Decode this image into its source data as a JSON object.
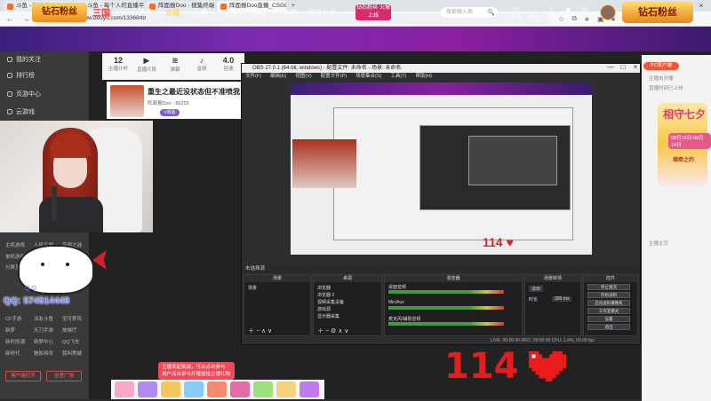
{
  "browser": {
    "tabs": [
      {
        "label": "斗鱼 - 哪个赛程 Bing"
      },
      {
        "label": "斗鱼 - 每个人的直播平台"
      },
      {
        "label": "阵面报Doo - 搜集终端 - 斗鱼直"
      },
      {
        "label": "阵面报Doo直播_CSGO直播_斗鱼"
      }
    ],
    "url": "https://www.douyu.com/1336849"
  },
  "douyu_header": {
    "logo": "钻石粉丝",
    "game_badge": "三国",
    "nav": [
      "首页",
      "直播",
      "分类",
      "视频",
      "游戏",
      "鱼吧",
      "相守七夕"
    ],
    "promo": "钻石粉丝 火爆上线",
    "search_placeholder": "搜索输入框",
    "icons": [
      "历史",
      "关注",
      "下载",
      "开播",
      "私信"
    ],
    "brand2": "钻石粉丝"
  },
  "sidebar": {
    "items": [
      "我的关注",
      "排行榜",
      "页游中心",
      "云游戏"
    ],
    "small": [
      "主机游戏",
      "人机互娱",
      "音频之谜",
      "单机游戏",
      "分屏显示",
      "单机英雄",
      "奇迹之旅",
      "CF手游",
      "派友斗鱼",
      "宝可梦风",
      "新梦",
      "天刀手游",
      "放映厅",
      "新时尚潮",
      "新梦中心",
      "QQ飞车",
      "新时代",
      "魅影特攻",
      "我叫秀城"
    ],
    "btn1": "客户端打开",
    "btn2": "创意广场"
  },
  "stats": [
    {
      "value": "12",
      "label": "主播计时"
    },
    {
      "value": "",
      "label": "直播片段"
    },
    {
      "value": "",
      "label": "弹幕"
    },
    {
      "value": "",
      "label": "音频"
    },
    {
      "value": "4.0",
      "label": "倍速"
    }
  ],
  "anchor": {
    "title": "重生之最近没状态但不准喷我！",
    "name": "阵面报Doo",
    "hot": "80255",
    "tag": "V观看"
  },
  "overlay": {
    "qq": "QQ: 574514448",
    "hint": "Q Q",
    "count": "114"
  },
  "obs": {
    "title": "OBS 27.0.1 (64-bit, windows) - 配置文件: 未命名 - 场景: 未命名",
    "menu": [
      "文件(F)",
      "编辑(E)",
      "视图(V)",
      "配置文件(P)",
      "场景集合(S)",
      "工具(T)",
      "帮助(H)"
    ],
    "scene_bar": "未选择源",
    "panels": {
      "scenes": {
        "header": "场景",
        "items": [
          "场景"
        ]
      },
      "sources": {
        "header": "来源",
        "items": [
          "浏览器",
          "浏览器 2",
          "视频采集设备",
          "游戏源",
          "显示器采集"
        ]
      },
      "mixer": {
        "header": "混音器",
        "tracks": [
          "桌面音频",
          "Mic/Aux",
          "麦克风/辅助音频"
        ]
      },
      "transitions": {
        "header": "场景转场",
        "type": "淡出",
        "duration_label": "时长",
        "duration": "300 ms"
      },
      "controls": {
        "header": "控件",
        "buttons": [
          "停止推流",
          "开始录制",
          "启动虚拟摄像机",
          "工作室模式",
          "设置",
          "退出"
        ]
      }
    },
    "status": "LIVE: 00:00:00    REC: 00:00:00    CPU: 1.4%, 60.00 fps"
  },
  "right_panel": {
    "pc_btn": "PC客户端",
    "promo_title": "相守七夕",
    "promo_date": "08月12日-08月14日",
    "promo_sub": "缘牵之约",
    "lines": [
      "主播未开播",
      "直播时间已上线",
      "主播主页"
    ]
  },
  "danmu_tip": "主播发起挑战，可以点击参与 用户点击参与并赠送给主播礼物",
  "colors": {
    "douyu_orange": "#f46b2a",
    "douyu_purple": "#7b2bb0",
    "obs_bg": "#2d2e30",
    "heart_red": "#e81c1c",
    "qq_blue": "#6b7cff"
  }
}
